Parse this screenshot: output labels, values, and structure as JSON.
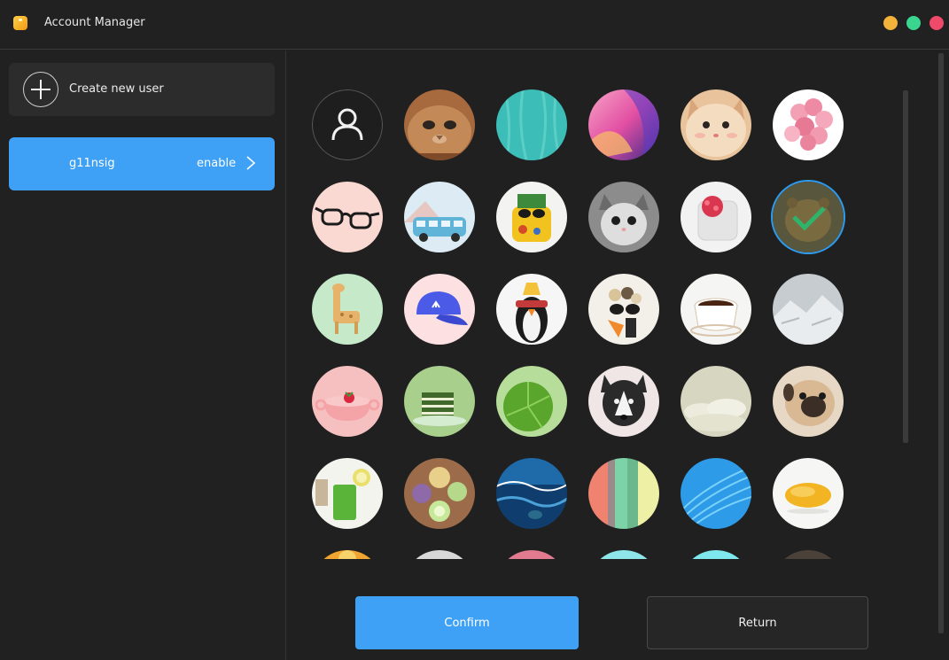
{
  "window": {
    "title": "Account Manager",
    "controls": [
      "minimize",
      "maximize",
      "close"
    ],
    "colors": {
      "minimize": "#f3b23a",
      "maximize": "#3ad58f",
      "close": "#f04a6a"
    }
  },
  "sidebar": {
    "create_label": "Create new user",
    "users": [
      {
        "name": "g11nsig",
        "status": "enable",
        "selected": true
      }
    ]
  },
  "avatars": [
    [
      "default-user",
      "cat-closeup",
      "teal-water",
      "pink-gradient",
      "fluffy-cat",
      "pink-balloons"
    ],
    [
      "glasses",
      "blue-van",
      "yellow-phone-sunglasses",
      "gray-kitten",
      "berry-dessert",
      "brown-bear-selected"
    ],
    [
      "giraffe-toy",
      "blue-cap",
      "penguin-sunglasses",
      "bird-sunglasses",
      "coffee-cup",
      "snowy-mountain"
    ],
    [
      "strawberry-bowl",
      "matcha-cake",
      "green-leaf",
      "husky",
      "clouds",
      "pug"
    ],
    [
      "green-juice",
      "drinks-top-view",
      "ocean-wave",
      "color-stripes",
      "blue-waves",
      "mango"
    ],
    [
      "orange-partial",
      "gray-partial",
      "pink-partial",
      "cyan-partial",
      "cyan-partial-2",
      "dark-partial"
    ]
  ],
  "selected_avatar": "brown-bear-selected",
  "buttons": {
    "confirm": "Confirm",
    "return": "Return"
  },
  "accent": "#3fa1f6"
}
